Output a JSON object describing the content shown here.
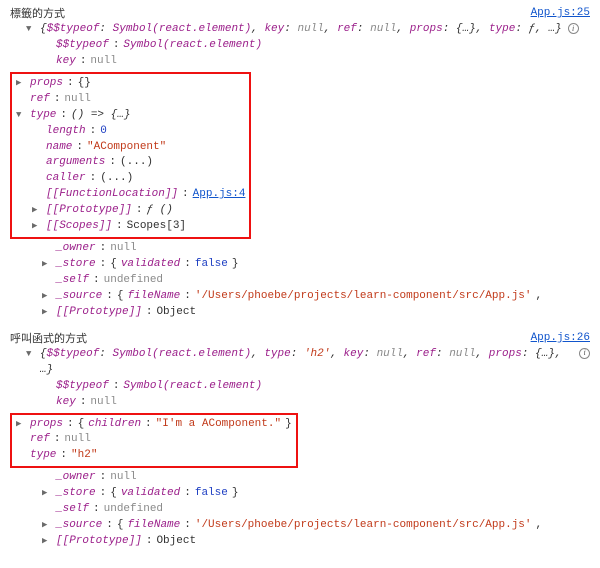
{
  "blocks": [
    {
      "label": "標籤的方式",
      "source_link": "App.js:25",
      "top_preview": {
        "typeof_k": "$$typeof",
        "typeof_v": "Symbol(react.element)",
        "key_k": "key",
        "key_v": "null",
        "ref_k": "ref",
        "ref_v": "null",
        "props_k": "props",
        "props_v": "{…}",
        "type_k": "type",
        "type_v": "ƒ",
        "tail": ", …}"
      },
      "lines_before_box": [
        {
          "key": "$$typeof",
          "val": "Symbol(react.element)",
          "vclass": "sym",
          "tri": "none"
        },
        {
          "key": "key",
          "val": "null",
          "vclass": "nullv",
          "tri": "none"
        }
      ],
      "box": [
        {
          "tri": "right",
          "parts": [
            {
              "k": "props",
              "sep": ": "
            },
            {
              "raw": "{}",
              "c": "obj"
            }
          ]
        },
        {
          "tri": "none",
          "parts": [
            {
              "k": "ref",
              "sep": ": "
            },
            {
              "raw": "null",
              "c": "nullv"
            }
          ]
        },
        {
          "tri": "down",
          "parts": [
            {
              "k": "type",
              "sep": ": "
            },
            {
              "raw": "() => {…}",
              "c": "fn"
            }
          ]
        },
        {
          "ind": 1,
          "tri": "none",
          "parts": [
            {
              "k": "length",
              "sep": ": "
            },
            {
              "raw": "0",
              "c": "num"
            }
          ]
        },
        {
          "ind": 1,
          "tri": "none",
          "parts": [
            {
              "k": "name",
              "sep": ": "
            },
            {
              "raw": "\"AComponent\"",
              "c": "str"
            }
          ]
        },
        {
          "ind": 1,
          "tri": "none",
          "parts": [
            {
              "k": "arguments",
              "sep": ": "
            },
            {
              "raw": "(...)",
              "c": "obj"
            }
          ]
        },
        {
          "ind": 1,
          "tri": "none",
          "parts": [
            {
              "k": "caller",
              "sep": ": "
            },
            {
              "raw": "(...)",
              "c": "obj"
            }
          ]
        },
        {
          "ind": 1,
          "tri": "none",
          "parts": [
            {
              "k": "[[FunctionLocation]]",
              "sep": ": "
            },
            {
              "raw": "App.js:4",
              "c": "link"
            }
          ]
        },
        {
          "ind": 1,
          "tri": "right",
          "parts": [
            {
              "k": "[[Prototype]]",
              "sep": ": "
            },
            {
              "raw": "ƒ ()",
              "c": "fn"
            }
          ]
        },
        {
          "ind": 1,
          "tri": "right",
          "parts": [
            {
              "k": "[[Scopes]]",
              "sep": ": "
            },
            {
              "raw": "Scopes[3]",
              "c": "obj"
            }
          ]
        }
      ],
      "lines_after_box": [
        {
          "tri": "none",
          "parts": [
            {
              "k": "_owner",
              "sep": ": "
            },
            {
              "raw": "null",
              "c": "nullv"
            }
          ]
        },
        {
          "tri": "right",
          "parts": [
            {
              "k": "_store",
              "sep": ": "
            },
            {
              "raw": "{",
              "c": "obj"
            },
            {
              "k2": "validated",
              "sep2": ": "
            },
            {
              "raw2": "false",
              "c2": "bool"
            },
            {
              "raw3": "}",
              "c3": "obj"
            }
          ]
        },
        {
          "tri": "none",
          "parts": [
            {
              "k": "_self",
              "sep": ": "
            },
            {
              "raw": "undefined",
              "c": "nullv"
            }
          ]
        },
        {
          "tri": "right",
          "parts": [
            {
              "k": "_source",
              "sep": ": "
            },
            {
              "raw": "{",
              "c": "obj"
            },
            {
              "k2": "fileName",
              "sep2": ": "
            },
            {
              "raw2": "'/Users/phoebe/projects/learn-component/src/App.js'",
              "c2": "str"
            },
            {
              "raw3": ",",
              "c3": "obj"
            }
          ]
        },
        {
          "tri": "right",
          "parts": [
            {
              "k": "[[Prototype]]",
              "sep": ": "
            },
            {
              "raw": "Object",
              "c": "obj"
            }
          ]
        }
      ]
    },
    {
      "label": "呼叫函式的方式",
      "source_link": "App.js:26",
      "top_preview": {
        "typeof_k": "$$typeof",
        "typeof_v": "Symbol(react.element)",
        "type_k": "type",
        "type_v": "'h2'",
        "key_k": "key",
        "key_v": "null",
        "ref_k": "ref",
        "ref_v": "null",
        "props_k": "props",
        "props_v": "{…}",
        "tail": ", …}"
      },
      "lines_before_box": [
        {
          "key": "$$typeof",
          "val": "Symbol(react.element)",
          "vclass": "sym",
          "tri": "none"
        },
        {
          "key": "key",
          "val": "null",
          "vclass": "nullv",
          "tri": "none"
        }
      ],
      "box": [
        {
          "tri": "right",
          "parts": [
            {
              "k": "props",
              "sep": ": "
            },
            {
              "raw": "{",
              "c": "obj"
            },
            {
              "k2": "children",
              "sep2": ": "
            },
            {
              "raw2": "\"I'm a AComponent.\"",
              "c2": "str"
            },
            {
              "raw3": "}",
              "c3": "obj"
            }
          ]
        },
        {
          "tri": "none",
          "parts": [
            {
              "k": "ref",
              "sep": ": "
            },
            {
              "raw": "null",
              "c": "nullv"
            }
          ]
        },
        {
          "tri": "none",
          "parts": [
            {
              "k": "type",
              "sep": ": "
            },
            {
              "raw": "\"h2\"",
              "c": "str"
            }
          ]
        }
      ],
      "lines_after_box": [
        {
          "tri": "none",
          "parts": [
            {
              "k": "_owner",
              "sep": ": "
            },
            {
              "raw": "null",
              "c": "nullv"
            }
          ]
        },
        {
          "tri": "right",
          "parts": [
            {
              "k": "_store",
              "sep": ": "
            },
            {
              "raw": "{",
              "c": "obj"
            },
            {
              "k2": "validated",
              "sep2": ": "
            },
            {
              "raw2": "false",
              "c2": "bool"
            },
            {
              "raw3": "}",
              "c3": "obj"
            }
          ]
        },
        {
          "tri": "none",
          "parts": [
            {
              "k": "_self",
              "sep": ": "
            },
            {
              "raw": "undefined",
              "c": "nullv"
            }
          ]
        },
        {
          "tri": "right",
          "parts": [
            {
              "k": "_source",
              "sep": ": "
            },
            {
              "raw": "{",
              "c": "obj"
            },
            {
              "k2": "fileName",
              "sep2": ": "
            },
            {
              "raw2": "'/Users/phoebe/projects/learn-component/src/App.js'",
              "c2": "str"
            },
            {
              "raw3": ",",
              "c3": "obj"
            }
          ]
        },
        {
          "tri": "right",
          "parts": [
            {
              "k": "[[Prototype]]",
              "sep": ": "
            },
            {
              "raw": "Object",
              "c": "obj"
            }
          ]
        }
      ]
    }
  ],
  "icons": {
    "info": "i"
  }
}
